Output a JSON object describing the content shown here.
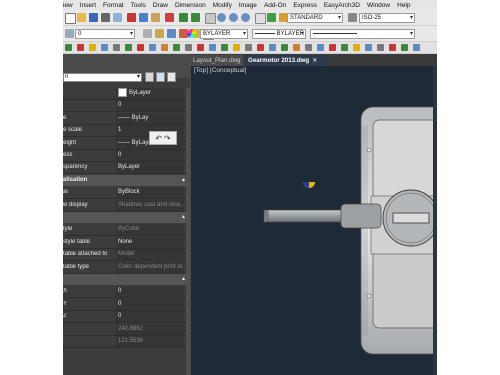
{
  "menu": [
    "iew",
    "Insert",
    "Format",
    "Tools",
    "Draw",
    "Dimension",
    "Modify",
    "Image",
    "Add-On",
    "Express",
    "EasyArch3D",
    "Window",
    "Help"
  ],
  "toolbar": {
    "textstyle": "STANDARD",
    "dimstyle": "ISO-25",
    "layer": "0",
    "color": "BYLAYER",
    "linetype": "BYLAYER"
  },
  "palette": {
    "selection": "n",
    "general_rows": [
      {
        "label": "",
        "value": "ByLayer",
        "swatch": true
      },
      {
        "label": "",
        "value": "0"
      },
      {
        "label": "e",
        "value": "—— ByLay"
      },
      {
        "label": "e scale",
        "value": "1"
      },
      {
        "label": "eight",
        "value": "—— ByLayer"
      },
      {
        "label": "ess",
        "value": "0"
      },
      {
        "label": "sparency",
        "value": "ByLayer"
      }
    ],
    "visualisation_title": "alisation",
    "visualisation_rows": [
      {
        "label": "al",
        "value": "ByBlock",
        "dim": false
      },
      {
        "label": "w display",
        "value": "Shadows cast and rece...",
        "dim": true
      }
    ],
    "plot_title": "",
    "plot_rows": [
      {
        "label": "tyle",
        "value": "ByColor",
        "dim": true
      },
      {
        "label": "style table",
        "value": "None",
        "dim": false
      },
      {
        "label": "table attached to",
        "value": "Model",
        "dim": true
      },
      {
        "label": "table type",
        "value": "Color dependent print st...",
        "dim": true
      }
    ],
    "geometry_rows": [
      {
        "label": "X",
        "value": "0",
        "dim": false
      },
      {
        "label": "Y",
        "value": "0",
        "dim": false
      },
      {
        "label": "Z",
        "value": "0",
        "dim": false
      },
      {
        "label": "",
        "value": "242.8662",
        "dim": true
      },
      {
        "label": "",
        "value": "121.5536",
        "dim": true
      }
    ]
  },
  "tabs": [
    {
      "label": "Layout_Plan.dwg",
      "active": false
    },
    {
      "label": "Gearmotor 2013.dwg",
      "active": true
    }
  ],
  "viewport": {
    "label": "[Top] [Conceptual]"
  },
  "colors": {
    "background": "#1f2a38",
    "motor_body": "#d2d4d6",
    "motor_accent": "#f5c000",
    "shaft": "#8e9296"
  }
}
